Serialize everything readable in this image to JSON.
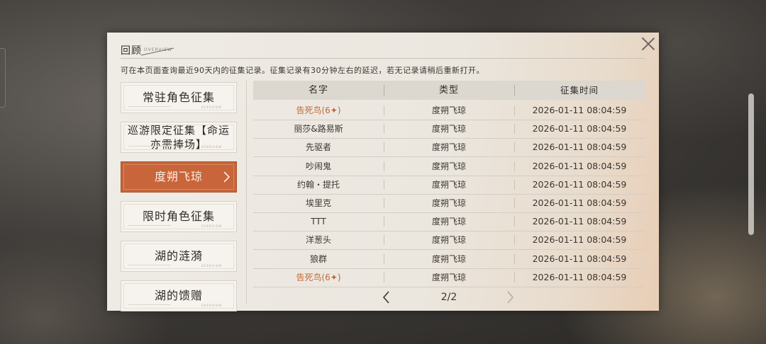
{
  "header": {
    "title": "回顾",
    "title_en": "OVERVIEW",
    "description": "可在本页面查询最近90天内的征集记录。征集记录有30分钟左右的延迟，若无记录请稍后重新打开。"
  },
  "categories": [
    {
      "label": "常驻角色征集",
      "deco": "OVERVIEW"
    },
    {
      "label": "巡游限定征集【命运亦需捧场】",
      "deco": "OVERVIEW"
    },
    {
      "label": "度朔飞琼",
      "deco": ""
    },
    {
      "label": "限时角色征集",
      "deco": "OVERVIEW"
    },
    {
      "label": "湖的涟漪",
      "deco": "OVERVIEW"
    },
    {
      "label": "湖的馈赠",
      "deco": "OVERVIEW"
    }
  ],
  "table": {
    "columns": [
      "名字",
      "类型",
      "征集时间"
    ],
    "rows": [
      {
        "name": "告死鸟(6✦)",
        "type": "度朔飞琼",
        "time": "2026-01-11 08:04:59",
        "highlight": true
      },
      {
        "name": "丽莎&路易斯",
        "type": "度朔飞琼",
        "time": "2026-01-11 08:04:59",
        "highlight": false
      },
      {
        "name": "先驱者",
        "type": "度朔飞琼",
        "time": "2026-01-11 08:04:59",
        "highlight": false
      },
      {
        "name": "吵闹鬼",
        "type": "度朔飞琼",
        "time": "2026-01-11 08:04:59",
        "highlight": false
      },
      {
        "name": "约翰・提托",
        "type": "度朔飞琼",
        "time": "2026-01-11 08:04:59",
        "highlight": false
      },
      {
        "name": "埃里克",
        "type": "度朔飞琼",
        "time": "2026-01-11 08:04:59",
        "highlight": false
      },
      {
        "name": "TTT",
        "type": "度朔飞琼",
        "time": "2026-01-11 08:04:59",
        "highlight": false
      },
      {
        "name": "洋葱头",
        "type": "度朔飞琼",
        "time": "2026-01-11 08:04:59",
        "highlight": false
      },
      {
        "name": "狼群",
        "type": "度朔飞琼",
        "time": "2026-01-11 08:04:59",
        "highlight": false
      },
      {
        "name": "告死鸟(6✦)",
        "type": "度朔飞琼",
        "time": "2026-01-11 08:04:59",
        "highlight": true
      }
    ]
  },
  "pager": {
    "text": "2/2"
  },
  "colors": {
    "accent": "#c9653a",
    "highlight_text": "#c0683a",
    "panel_bg": "#efece6"
  },
  "icons": {
    "close": "close-icon",
    "prev": "chevron-left-icon",
    "next": "chevron-right-icon",
    "active_arrow": "chevron-right-icon"
  }
}
